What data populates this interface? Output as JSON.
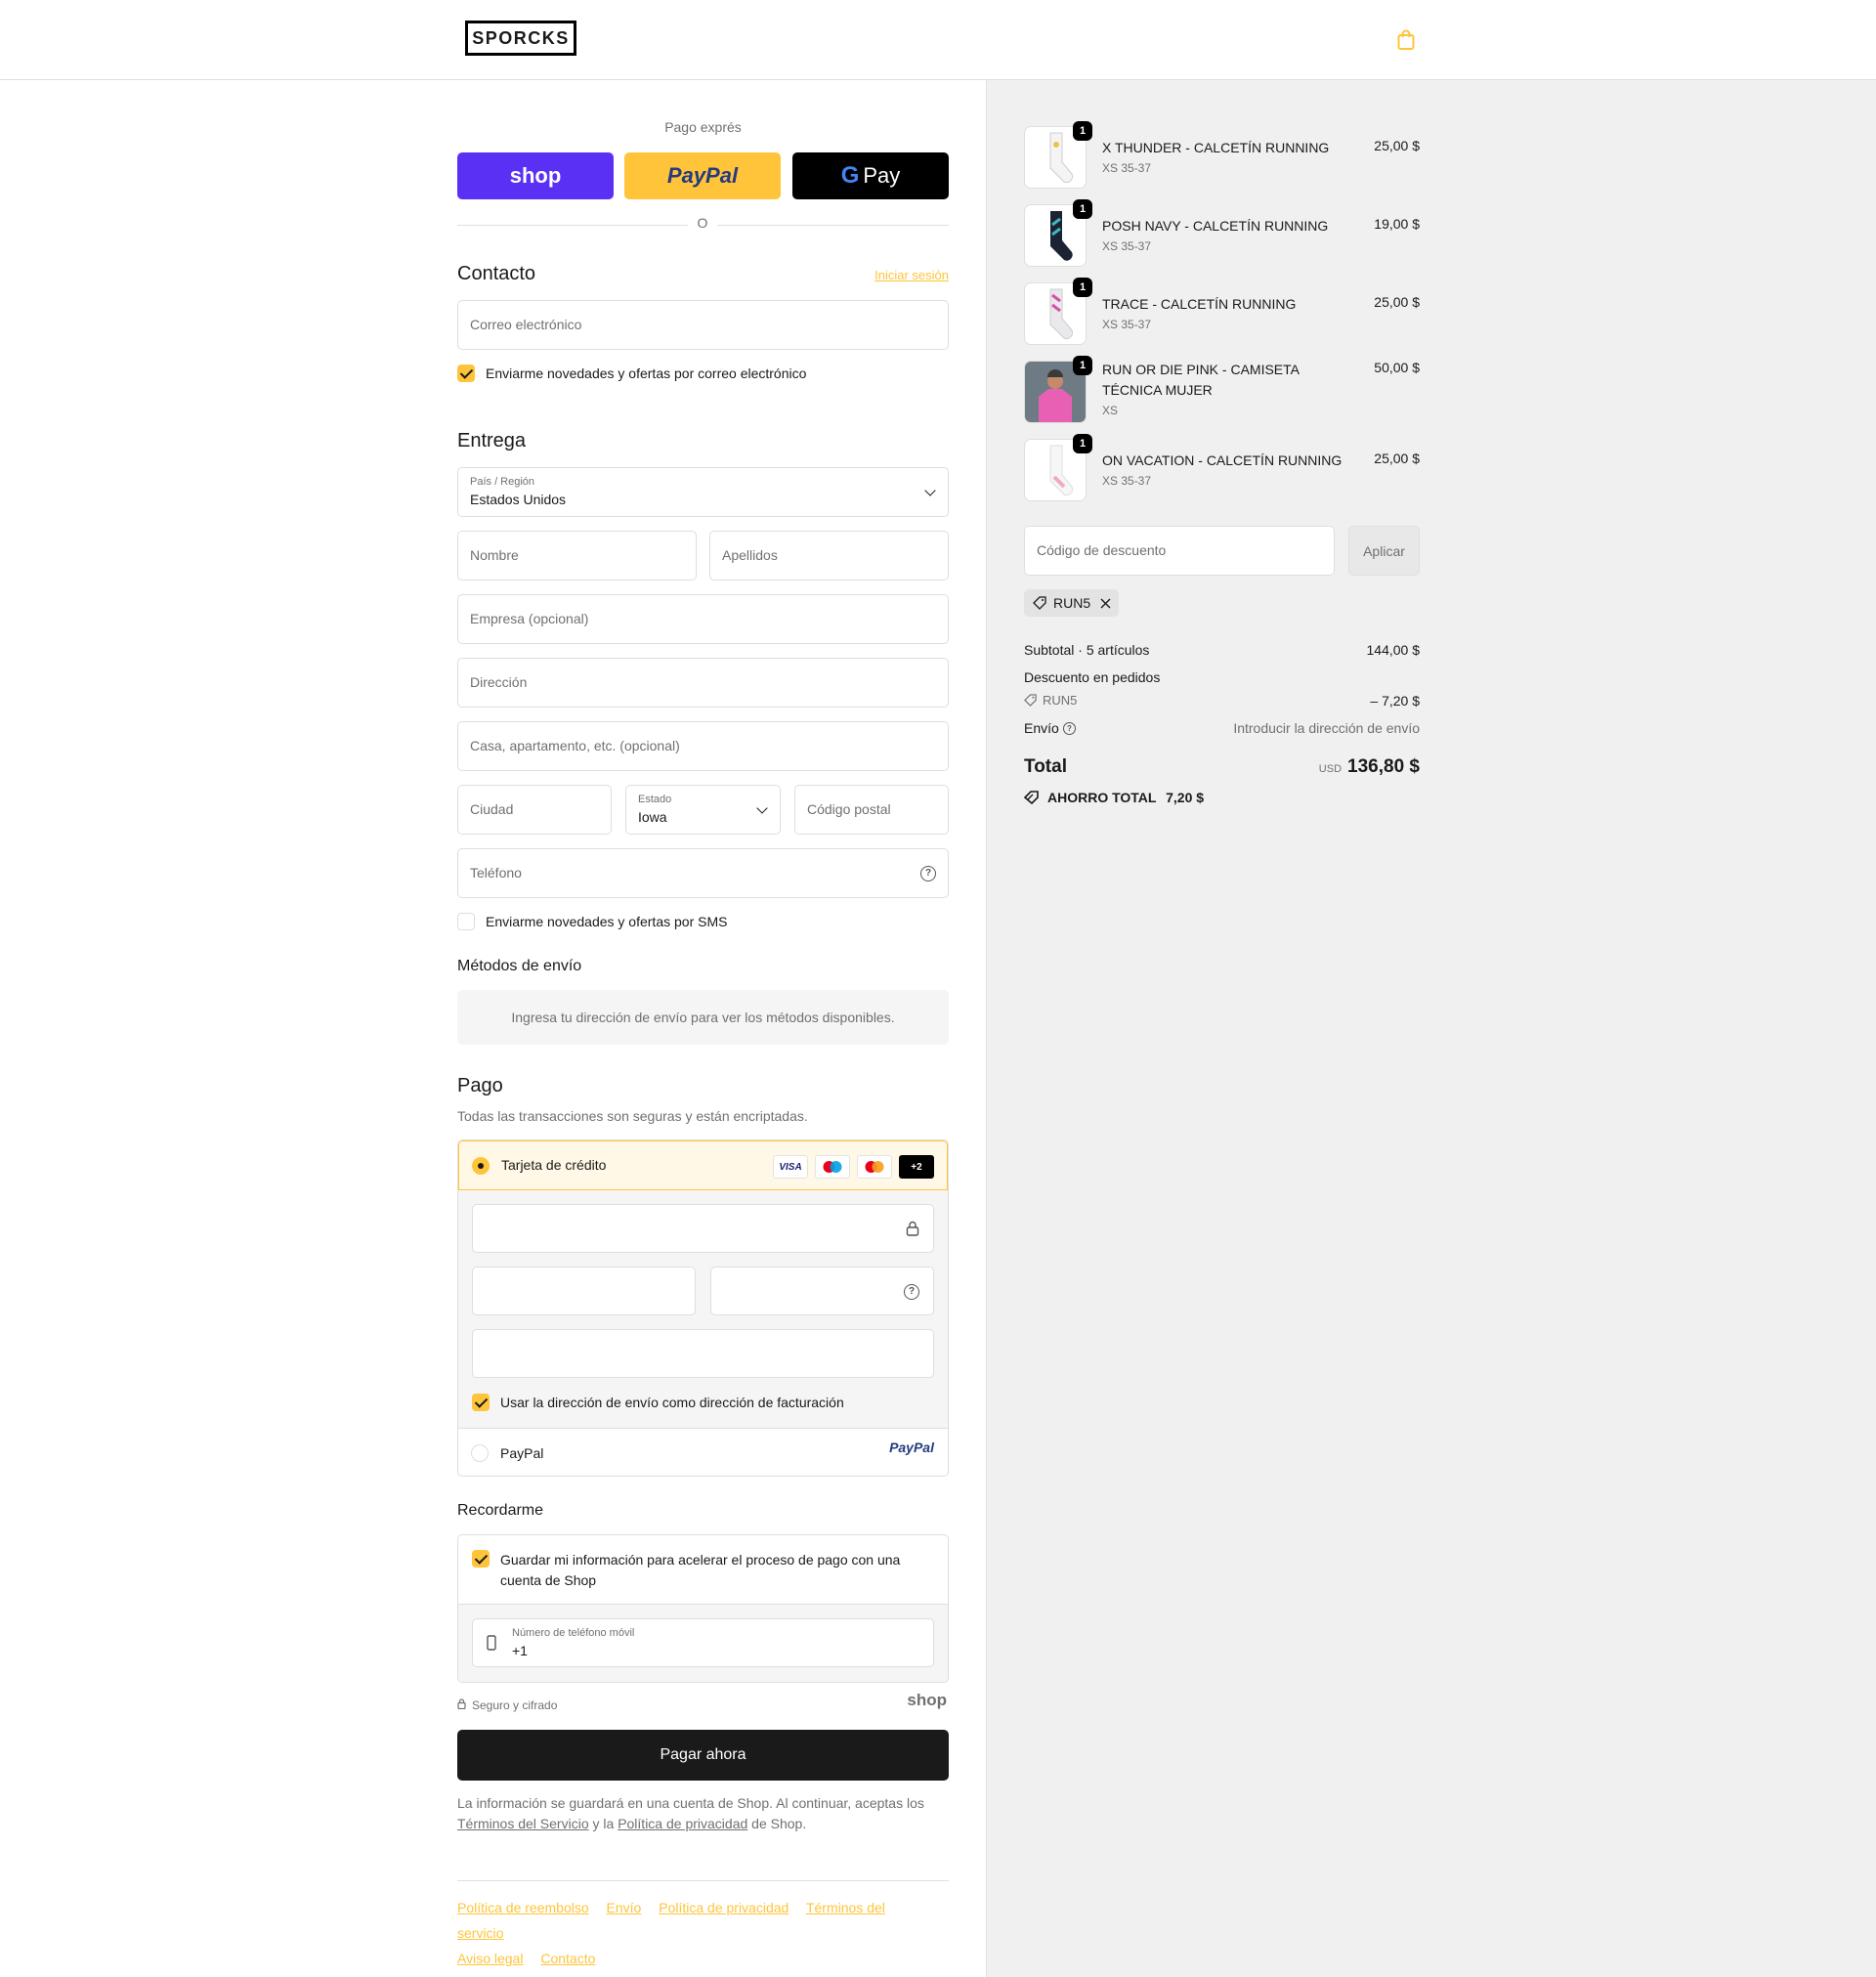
{
  "brand": {
    "logo_text": "SPORCKS",
    "accent": "#ffc439",
    "shop_purple": "#5a31f4"
  },
  "header": {
    "cart_icon": "shopping-bag-icon"
  },
  "express": {
    "title": "Pago exprés",
    "shop_label": "shop",
    "paypal_label": "PayPal",
    "gpay_label": "Pay",
    "gpay_g": "G",
    "or": "O"
  },
  "contact": {
    "title": "Contacto",
    "login_link": "Iniciar sesión",
    "email_placeholder": "Correo electrónico",
    "newsletter_label": "Enviarme novedades y ofertas por correo electrónico",
    "newsletter_checked": true
  },
  "delivery": {
    "title": "Entrega",
    "country_label": "País / Región",
    "country_value": "Estados Unidos",
    "first_name_placeholder": "Nombre",
    "last_name_placeholder": "Apellidos",
    "company_placeholder": "Empresa (opcional)",
    "address_placeholder": "Dirección",
    "apartment_placeholder": "Casa, apartamento, etc. (opcional)",
    "city_placeholder": "Ciudad",
    "state_label": "Estado",
    "state_value": "Iowa",
    "zip_placeholder": "Código postal",
    "phone_placeholder": "Teléfono",
    "sms_label": "Enviarme novedades y ofertas por SMS",
    "sms_checked": false
  },
  "shipping_methods": {
    "title": "Métodos de envío",
    "notice": "Ingresa tu dirección de envío para ver los métodos disponibles."
  },
  "payment": {
    "title": "Pago",
    "subtitle": "Todas las transacciones son seguras y están encriptadas.",
    "credit_card_label": "Tarjeta de crédito",
    "card_logos": [
      "VISA",
      "Maestro",
      "Mastercard"
    ],
    "more_cards": "+2",
    "billing_same_label": "Usar la dirección de envío como dirección de facturación",
    "billing_same_checked": true,
    "paypal_option_label": "PayPal",
    "paypal_logo": "PayPal"
  },
  "remember": {
    "title": "Recordarme",
    "save_label": "Guardar mi información para acelerar el proceso de pago con una cuenta de Shop",
    "save_checked": true,
    "mobile_label": "Número de teléfono móvil",
    "mobile_value": "+1",
    "secure_text": "Seguro y cifrado",
    "shop_logo": "shop"
  },
  "pay_button": "Pagar ahora",
  "legal": {
    "line1": "La información se guardará en una cuenta de Shop. Al continuar, aceptas los",
    "terms": "Términos del Servicio",
    "and": "y la",
    "privacy": "Política de privacidad",
    "suffix": "de Shop."
  },
  "footer_links": [
    "Política de reembolso",
    "Envío",
    "Política de privacidad",
    "Términos del servicio",
    "Aviso legal",
    "Contacto"
  ],
  "order": {
    "items": [
      {
        "name": "X THUNDER - CALCETÍN RUNNING",
        "variant": "XS 35-37",
        "price": "25,00 $",
        "qty": "1",
        "color": "#f4f4f4",
        "accent": "#e8c547"
      },
      {
        "name": "POSH NAVY - CALCETÍN RUNNING",
        "variant": "XS 35-37",
        "price": "19,00 $",
        "qty": "1",
        "color": "#1c2433",
        "accent": "#3fb8c2"
      },
      {
        "name": "TRACE - CALCETÍN RUNNING",
        "variant": "XS 35-37",
        "price": "25,00 $",
        "qty": "1",
        "color": "#e9e9ec",
        "accent": "#d64fa8"
      },
      {
        "name": "RUN OR DIE PINK - CAMISETA TÉCNICA MUJER",
        "variant": "XS",
        "price": "50,00 $",
        "qty": "1",
        "color": "#e860b4",
        "accent": "#3a3a3a"
      },
      {
        "name": "ON VACATION - CALCETÍN RUNNING",
        "variant": "XS 35-37",
        "price": "25,00 $",
        "qty": "1",
        "color": "#f6f6f6",
        "accent": "#f3a6c8"
      }
    ],
    "discount_placeholder": "Código de descuento",
    "apply_button": "Aplicar",
    "applied_code": "RUN5",
    "subtotal_label": "Subtotal · 5 artículos",
    "subtotal_value": "144,00 $",
    "discount_label": "Descuento en pedidos",
    "discount_code": "RUN5",
    "discount_value": "– 7,20 $",
    "shipping_label": "Envío",
    "shipping_value": "Introducir la dirección de envío",
    "total_label": "Total",
    "currency": "USD",
    "total_value": "136,80 $",
    "savings_label": "AHORRO TOTAL",
    "savings_value": "7,20 $"
  }
}
